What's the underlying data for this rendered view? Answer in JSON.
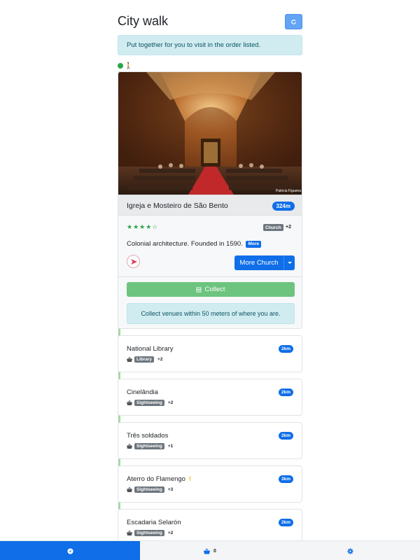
{
  "header": {
    "title": "City walk"
  },
  "intro_alert": "Put together for you to visit in the order listed.",
  "current_place": {
    "photo_credit": "Patricia Figueira",
    "name": "Igreja e Mosteiro de São Bento",
    "distance": "324m",
    "rating_stars": "★★★★☆",
    "rating": 4,
    "category": "Church",
    "category_more": "+2",
    "description": "Colonial architecture. Founded in 1590.",
    "more_label": "More",
    "more_church_label": "More Church",
    "collect_label": "Collect",
    "collect_hint": "Collect venues within 50 meters of where you are."
  },
  "venues": [
    {
      "name": "National Library",
      "distance": "2km",
      "category": "Library",
      "more": "+2",
      "emoji": ""
    },
    {
      "name": "Cinelândia",
      "distance": "2km",
      "category": "Sightseeing",
      "more": "+2",
      "emoji": ""
    },
    {
      "name": "Três soldados",
      "distance": "2km",
      "category": "Sightseeing",
      "more": "+1",
      "emoji": ""
    },
    {
      "name": "Aterro do Flamengo",
      "distance": "3km",
      "category": "Sightseeing",
      "more": "+3",
      "emoji": "✌"
    },
    {
      "name": "Escadaria Selarón",
      "distance": "2km",
      "category": "Sightseeing",
      "more": "+2",
      "emoji": ""
    }
  ],
  "bottom_nav": {
    "basket_count": "0"
  },
  "colors": {
    "primary": "#0f6ee8",
    "success": "#28a745",
    "info_bg": "#d1ecf1",
    "secondary": "#6c757d"
  }
}
